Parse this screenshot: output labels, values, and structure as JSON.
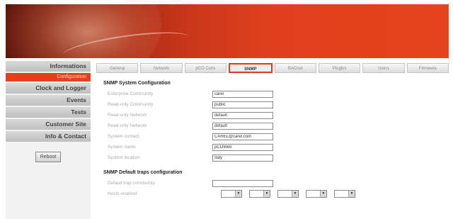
{
  "header": {
    "banner": ""
  },
  "sidebar": {
    "items": [
      {
        "label": "Informations"
      },
      {
        "label": "Configuration"
      },
      {
        "label": "Clock and Logger"
      },
      {
        "label": "Events"
      },
      {
        "label": "Tests"
      },
      {
        "label": "Customer Site"
      },
      {
        "label": "Info & Contact"
      }
    ],
    "reboot_label": "Reboot",
    "info": [
      "",
      "",
      "",
      ""
    ]
  },
  "tabs": [
    {
      "label": "General"
    },
    {
      "label": "Network"
    },
    {
      "label": "pCO Conv"
    },
    {
      "label": "SNMP"
    },
    {
      "label": "BACnet"
    },
    {
      "label": "Plugins"
    },
    {
      "label": "Users"
    },
    {
      "label": "Firmware"
    }
  ],
  "snmp": {
    "section_title": "SNMP System Configuration",
    "fields": [
      {
        "label": "Enterprise Community",
        "value": "carel"
      },
      {
        "label": "Read-only Community",
        "value": "public"
      },
      {
        "label": "Read-only Network",
        "value": "default"
      },
      {
        "label": "Read-only Network",
        "value": "default"
      },
      {
        "label": "System contact",
        "value": "CAREL@carel.com"
      },
      {
        "label": "System name",
        "value": "pCOWeb"
      },
      {
        "label": "System location",
        "value": "Italy"
      }
    ]
  },
  "traps": {
    "section_title": "SNMP Default traps configuration",
    "community_label": "Default trap community",
    "community_value": "",
    "enabled_label": "Hosts enabled",
    "selects": [
      "",
      "",
      "",
      "",
      ""
    ]
  }
}
